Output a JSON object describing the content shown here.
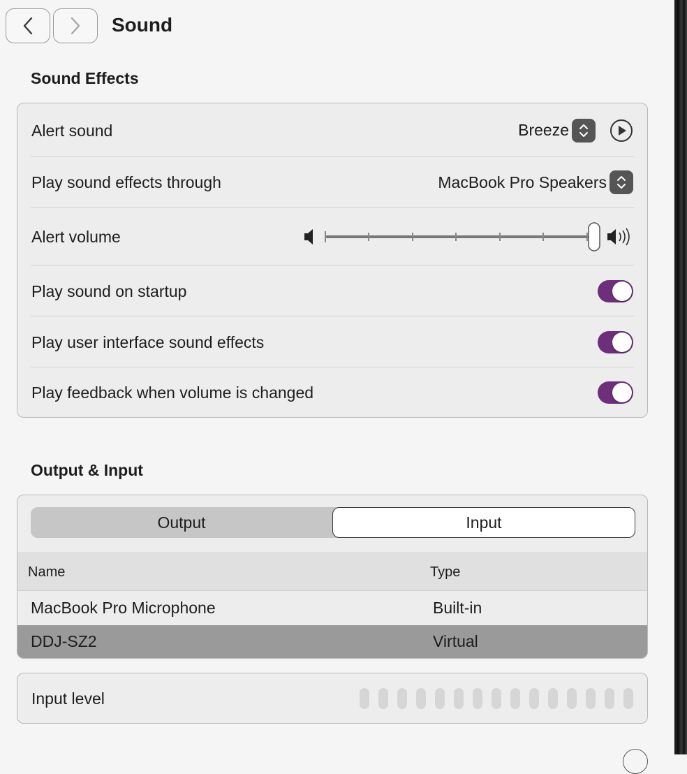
{
  "window": {
    "title": "Sound",
    "back_label": "‹",
    "forward_label": "›"
  },
  "sound_effects": {
    "section_title": "Sound Effects",
    "alert_sound": {
      "label": "Alert sound",
      "value": "Breeze"
    },
    "play_through": {
      "label": "Play sound effects through",
      "value": "MacBook Pro Speakers"
    },
    "alert_volume": {
      "label": "Alert volume",
      "level": 1.0
    },
    "startup": {
      "label": "Play sound on startup",
      "on": true
    },
    "ui_effects": {
      "label": "Play user interface sound effects",
      "on": true
    },
    "feedback": {
      "label": "Play feedback when volume is changed",
      "on": true
    }
  },
  "output_input": {
    "section_title": "Output & Input",
    "tabs": [
      {
        "label": "Output",
        "selected": false
      },
      {
        "label": "Input",
        "selected": true
      }
    ],
    "columns": {
      "name": "Name",
      "type": "Type"
    },
    "devices": [
      {
        "name": "MacBook Pro Microphone",
        "type": "Built-in",
        "selected": false
      },
      {
        "name": "DDJ-SZ2",
        "type": "Virtual",
        "selected": true
      }
    ],
    "input_level": {
      "label": "Input level",
      "bars": 15,
      "level": 0
    }
  },
  "colors": {
    "accent_toggle": "#6d2e7a",
    "selected_row": "#9a9a9a"
  },
  "icons": [
    "chevron-left-icon",
    "chevron-right-icon",
    "stepper-icon",
    "play-icon",
    "speaker-low-icon",
    "speaker-high-icon",
    "help-icon"
  ]
}
